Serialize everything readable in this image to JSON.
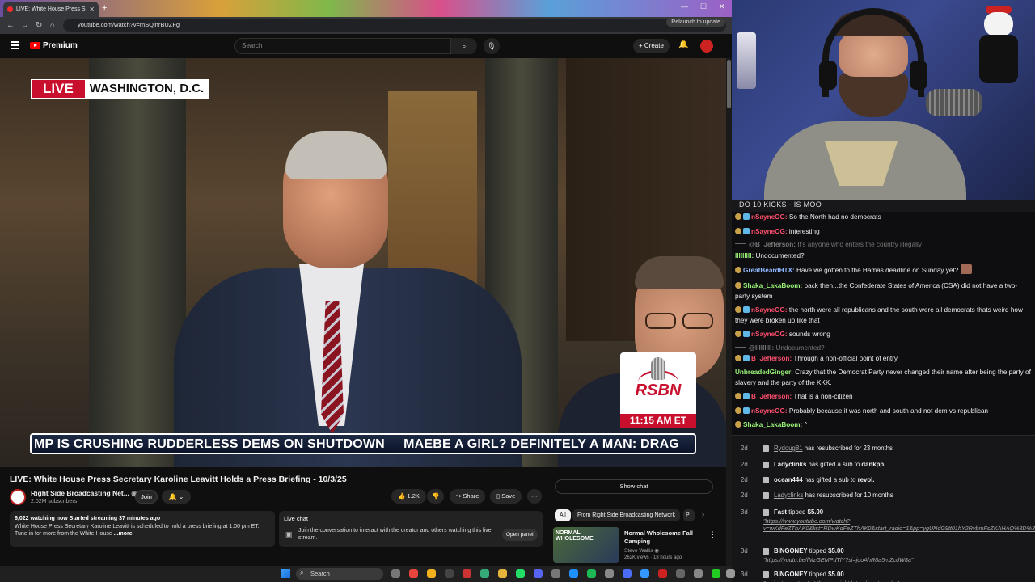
{
  "browser": {
    "tab_title": "LIVE: White House Press Se",
    "url": "youtube.com/watch?v=mSQjnrBUZFg",
    "relaunch_label": "Relaunch to update",
    "new_tab_label": "+"
  },
  "youtube": {
    "logo_text": "Premium",
    "search_placeholder": "Search",
    "create_label": "Create",
    "video": {
      "live_label": "LIVE",
      "location": "WASHINGTON, D.C.",
      "network": "RSBN",
      "time": "11:15 AM ET",
      "ticker": "MP IS CRUSHING RUDDERLESS DEMS ON SHUTDOWN     MAEBE A GIRL? DEFINITELY A MAN: DRAG"
    },
    "title": "LIVE: White House Press Secretary Karoline Leavitt Holds a Press Briefing - 10/3/25",
    "channel_name": "Right Side Broadcasting Net...",
    "subscribers": "2.02M subscribers",
    "join_label": "Join",
    "likes": "1.2K",
    "share_label": "Share",
    "save_label": "Save",
    "description": {
      "stats": "6,022 watching now  Started streaming 37 minutes ago",
      "line1": "White House Press Secretary Karoline Leavitt is scheduled to hold a press briefing at 1:00 pm ET.",
      "line2": "Tune in for more from the White House",
      "more": "...more"
    },
    "live_chat": {
      "title": "Live chat",
      "text": "Join the conversation to interact with the creator and others watching this live stream.",
      "open_panel": "Open panel"
    },
    "show_chat_label": "Show chat",
    "chips": [
      "All",
      "From Right Side Broadcasting Network",
      "P"
    ],
    "recommendation": {
      "thumb_text": "NORMAL WHOLESOME",
      "title": "Normal Wholesome Fall Camping",
      "channel": "Steve Wallis",
      "meta": "262K views · 18 hours ago"
    }
  },
  "stream_overlay": {
    "chat_header": "DO 10 KICKS - IS MOO",
    "messages": [
      {
        "user": "nSayneOG:",
        "text": "So the North had no democrats",
        "color": "#ff4f6d",
        "badges": [
          "sub",
          "blue"
        ]
      },
      {
        "user": "nSayneOG:",
        "text": "interesting",
        "color": "#ff4f6d",
        "badges": [
          "sub",
          "blue"
        ]
      },
      {
        "user": "@B_Jefferson:",
        "text": "It's anyone who enters the country illegally",
        "color": "#777777",
        "badges": [
          "dash"
        ],
        "dim": true
      },
      {
        "user": "lllllllll:",
        "text": "Undocumented?",
        "color": "#9cf57a",
        "badges": []
      },
      {
        "user": "GreatBeardHTX:",
        "text": "Have we gotten to the Hamas deadline on Sunday yet?",
        "color": "#8fb8ff",
        "badges": [
          "sub"
        ]
      },
      {
        "user": "Shaka_LakaBoom:",
        "text": "back then...the Confederate States of America (CSA) did not have a two-party system",
        "color": "#9cf57a",
        "badges": [
          "sub"
        ]
      },
      {
        "user": "nSayneOG:",
        "text": "the north were all republicans and the south were all democrats thats weird how they were broken up like that",
        "color": "#ff4f6d",
        "badges": [
          "sub",
          "blue"
        ]
      },
      {
        "user": "nSayneOG:",
        "text": "sounds wrong",
        "color": "#ff4f6d",
        "badges": [
          "sub",
          "blue"
        ]
      },
      {
        "user": "@lllllllll:",
        "text": "Undocumented?",
        "color": "#777777",
        "badges": [
          "dash"
        ],
        "dim": true
      },
      {
        "user": "B_Jefferson:",
        "text": "Through a non-official point of entry",
        "color": "#ff4f6d",
        "badges": [
          "sub",
          "blue"
        ]
      },
      {
        "user": "UnbreadedGinger:",
        "text": "Crazy that the Democrat Party never changed their name after being the party of slavery and the party of the KKK.",
        "color": "#9cf57a",
        "badges": []
      },
      {
        "user": "B_Jefferson:",
        "text": "That is a non-citizen",
        "color": "#ff4f6d",
        "badges": [
          "sub",
          "blue"
        ]
      },
      {
        "user": "nSayneOG:",
        "text": "Probably because it was north and south and not dem vs republican",
        "color": "#ff4f6d",
        "badges": [
          "sub",
          "blue"
        ]
      },
      {
        "user": "Shaka_LakaBoom:",
        "text": "^",
        "color": "#9cf57a",
        "badges": [
          "sub"
        ]
      }
    ],
    "events": [
      {
        "age": "2d",
        "user": "Rydoug81",
        "text": "has resubscribed for 23 months",
        "underline": true
      },
      {
        "age": "2d",
        "user": "Ladyclinks",
        "text": "has gifted a sub to",
        "target": "dankpp."
      },
      {
        "age": "2d",
        "user": "ocean444",
        "text": "has gifted a sub to",
        "target": "revol."
      },
      {
        "age": "2d",
        "user": "Ladyclinks",
        "text": "has resubscribed for 10 months",
        "underline": true
      },
      {
        "age": "3d",
        "user": "Fast",
        "text": "tipped",
        "amount": "$5.00",
        "link": "\"https://www.youtube.com/watch?v=wKdFeZThAK0&list=RDwKdFeZThAK0&start_radio=1&pp=ygUNdG9tt01hY2RvbmFsZKAHAQ%3D%3D\""
      },
      {
        "age": "3d",
        "user": "BINGONEY",
        "text": "tipped",
        "amount": "$5.00",
        "link": "\"https://youtu.be/fMzGEMPdTlY?si=jooAhR8a5mZcdW8a\""
      },
      {
        "age": "3d",
        "user": "BINGONEY",
        "text": "tipped",
        "amount": "$5.00",
        "link": "\"a nightmare to start the day right https://youtu.be/...\""
      }
    ]
  },
  "taskbar": {
    "search_label": "Search"
  }
}
